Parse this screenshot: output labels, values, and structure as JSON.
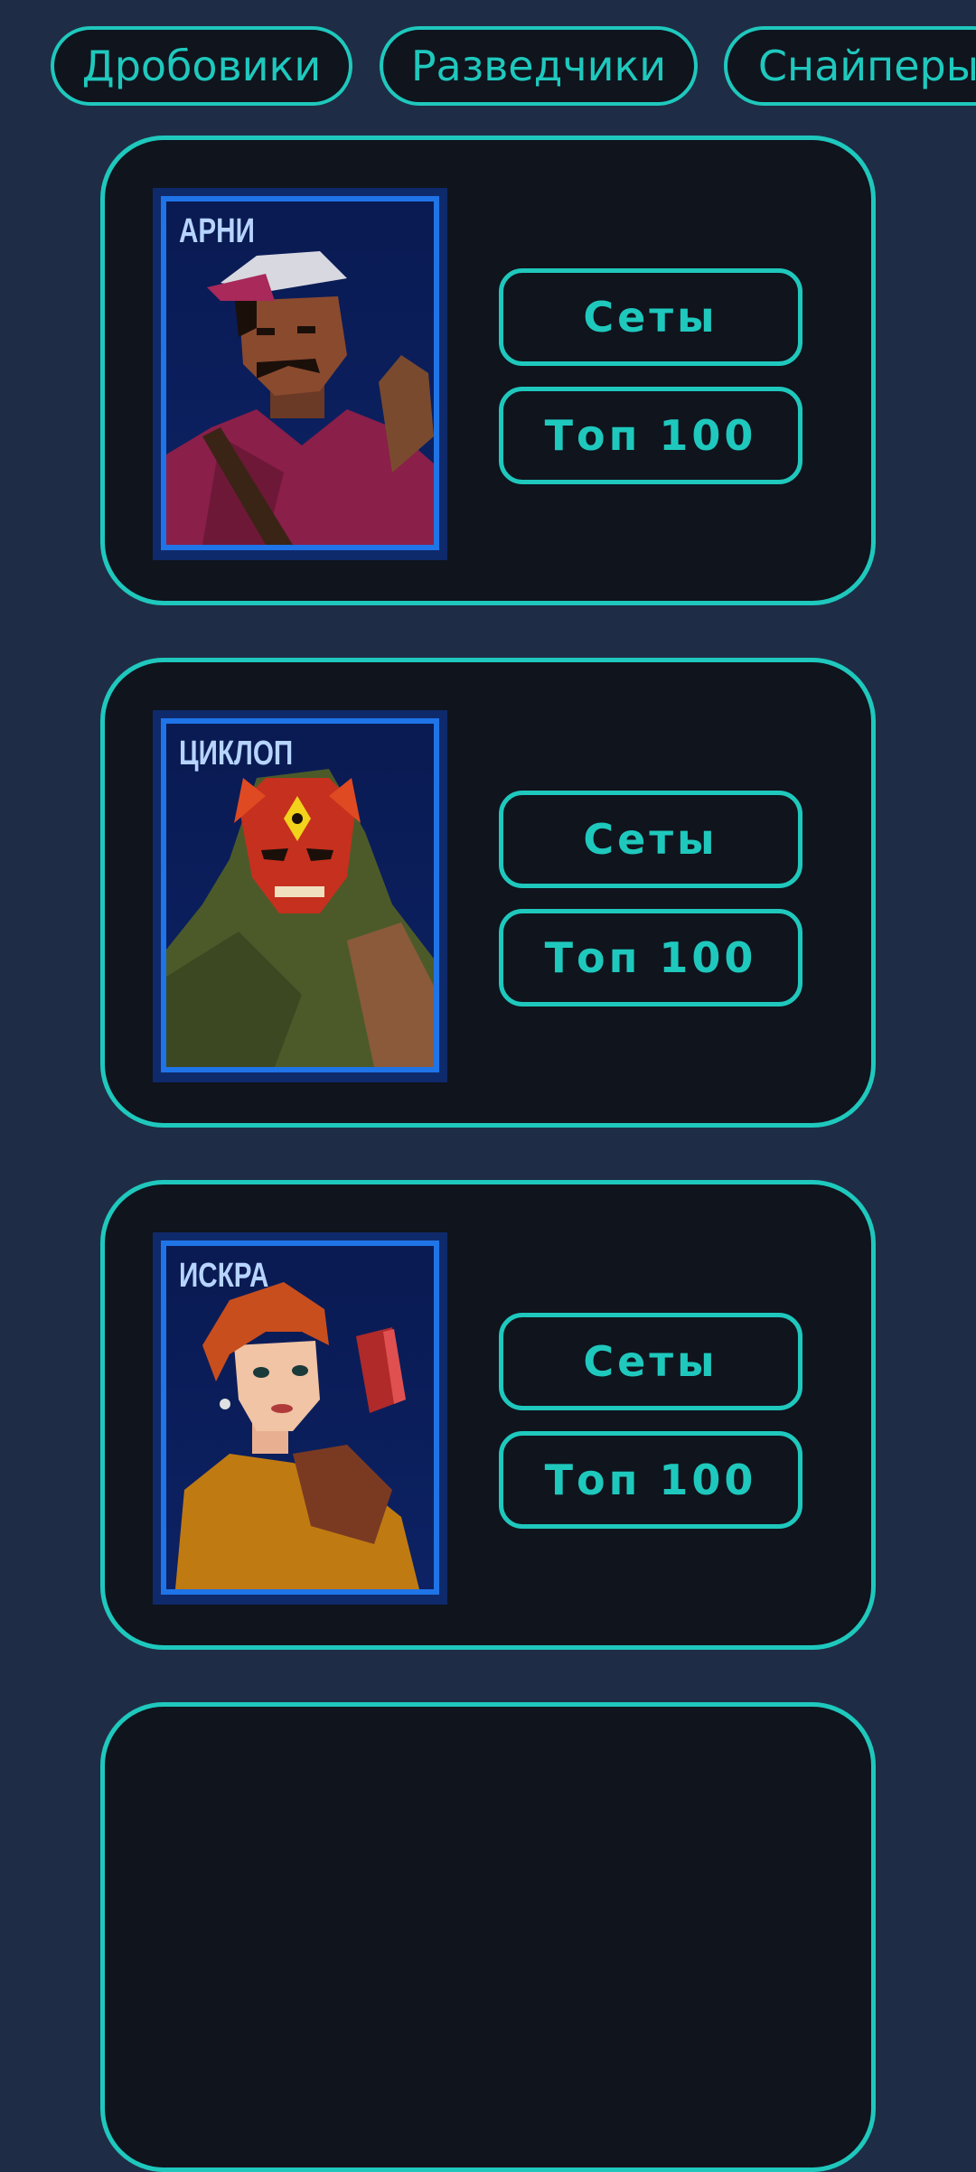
{
  "filter_chips": [
    {
      "label": "Дробовики"
    },
    {
      "label": "Разведчики"
    },
    {
      "label": "Снайперы"
    }
  ],
  "heroes": [
    {
      "name": "АРНИ",
      "sets_label": "Сеты",
      "top_label": "Топ 100",
      "art_icon": "hero-arni-portrait"
    },
    {
      "name": "ЦИКЛОП",
      "sets_label": "Сеты",
      "top_label": "Топ 100",
      "art_icon": "hero-cyclops-portrait"
    },
    {
      "name": "ИСКРА",
      "sets_label": "Сеты",
      "top_label": "Топ 100",
      "art_icon": "hero-iskra-portrait"
    }
  ],
  "colors": {
    "background": "#1e2d45",
    "card_background": "#0f141d",
    "accent": "#1fc8bd",
    "portrait_frame": "#1f74e8",
    "portrait_name": "#b6d4ff"
  }
}
